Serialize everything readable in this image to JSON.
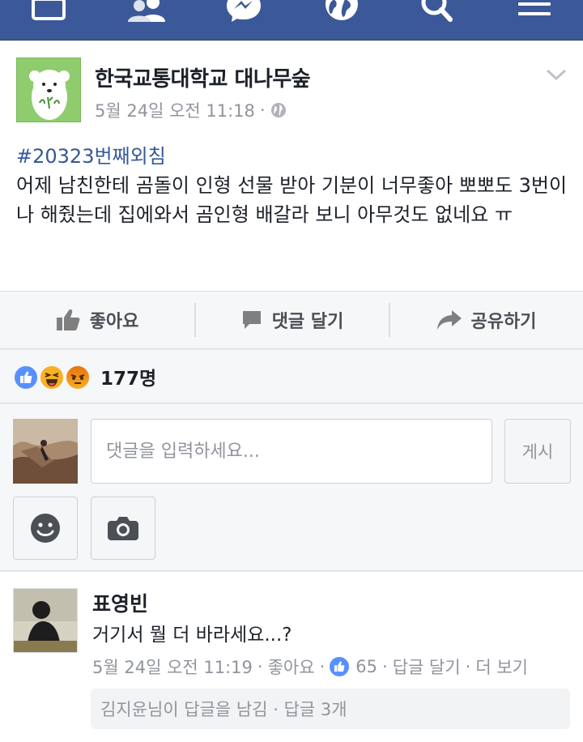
{
  "nav": {
    "items": [
      "home-icon",
      "friend-requests-icon",
      "messenger-icon",
      "notifications-globe-icon",
      "search-icon",
      "menu-icon"
    ],
    "bar_color": "#3b5998"
  },
  "post": {
    "page_name": "한국교통대학교 대나무숲",
    "timestamp": "5월 24일 오전 11:18",
    "meta_separator": "·",
    "privacy_icon": "globe-icon",
    "hashtag": "#20323번째외침",
    "body": "어제 남친한테 곰돌이 인형 선물 받아 기분이 너무좋아 뽀뽀도 3번이나 해줬는데 집에와서 곰인형 배갈라 보니 아무것도 없네요 ㅠ"
  },
  "actions": {
    "like": "좋아요",
    "comment": "댓글 달기",
    "share": "공유하기"
  },
  "reactions": {
    "icons": [
      "like-reaction-icon",
      "haha-reaction-icon",
      "angry-reaction-icon"
    ],
    "count": "177명"
  },
  "composer": {
    "placeholder": "댓글을 입력하세요...",
    "post_button": "게시"
  },
  "comment": {
    "author": "표영빈",
    "text": "거기서 뭘 더 바라세요...?",
    "timestamp": "5월 24일 오전 11:19",
    "like_link": "좋아요",
    "like_count": "65",
    "reply_link": "답글 달기",
    "more_link": "더 보기",
    "reply_preview": "김지윤님이 답글을 남김 · 답글 3개"
  },
  "colors": {
    "accent": "#365899",
    "like_blue": "#5890ff",
    "meta_gray": "#90949c"
  }
}
